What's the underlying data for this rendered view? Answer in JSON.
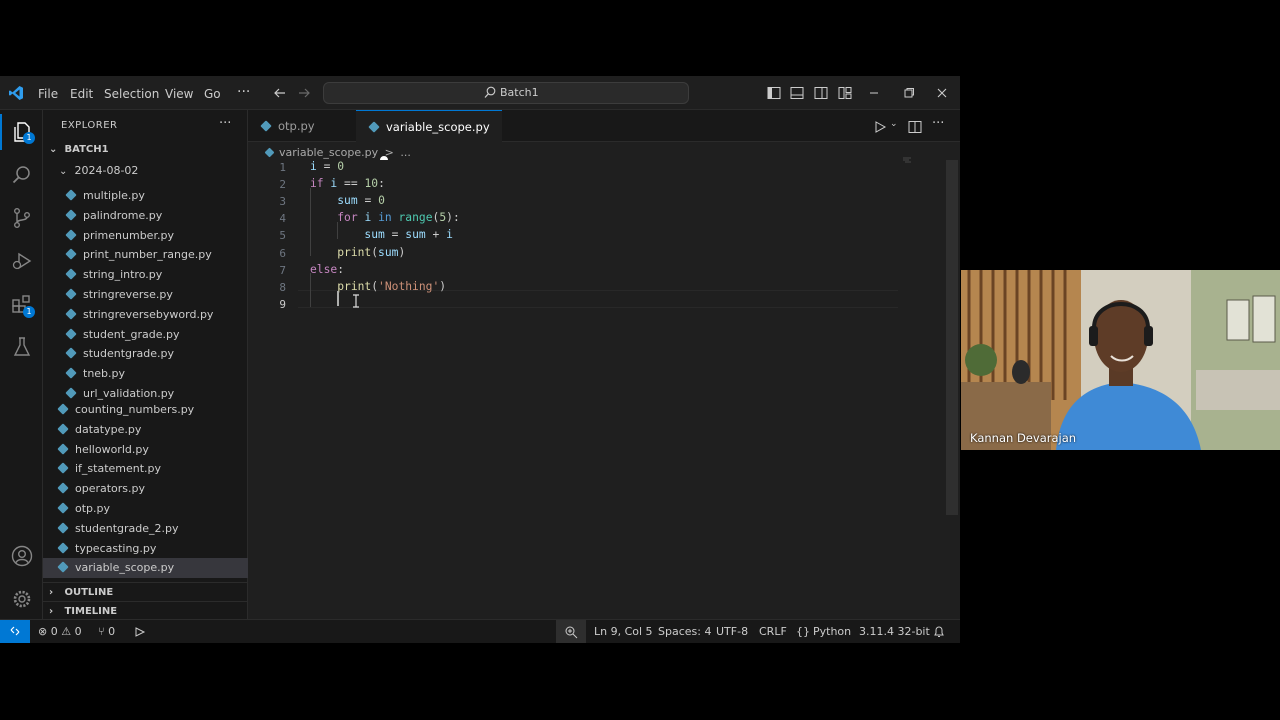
{
  "title_bar": {
    "menu": [
      "File",
      "Edit",
      "Selection",
      "View",
      "Go"
    ],
    "more": "···",
    "search_text": "Batch1"
  },
  "activity_bar": {
    "explorer_badge": "1",
    "extensions_badge": "1"
  },
  "sidebar": {
    "title": "EXPLORER",
    "more": "···",
    "workspace": "BATCH1",
    "folder": "2024-08-02",
    "folder_files": [
      "multiple.py",
      "palindrome.py",
      "primenumber.py",
      "print_number_range.py",
      "string_intro.py",
      "stringreverse.py",
      "stringreversebyword.py",
      "student_grade.py",
      "studentgrade.py",
      "tneb.py",
      "url_validation.py"
    ],
    "root_files": [
      "counting_numbers.py",
      "datatype.py",
      "helloworld.py",
      "if_statement.py",
      "operators.py",
      "otp.py",
      "studentgrade_2.py",
      "typecasting.py",
      "variable_scope.py"
    ],
    "active_file": "variable_scope.py",
    "outline": "OUTLINE",
    "timeline": "TIMELINE"
  },
  "tabs": [
    {
      "label": "otp.py",
      "active": false
    },
    {
      "label": "variable_scope.py",
      "active": true,
      "dirty": true
    }
  ],
  "breadcrumb": {
    "file": "variable_scope.py",
    "sep": ">",
    "more": "..."
  },
  "editor": {
    "line_numbers": [
      "1",
      "2",
      "3",
      "4",
      "5",
      "6",
      "7",
      "8",
      "9"
    ],
    "current_line": 9,
    "code_lines": [
      "i = 0",
      "if i == 10:",
      "    sum = 0",
      "    for i in range(5):",
      "        sum = sum + i",
      "    print(sum)",
      "else:",
      "    print('Nothing')",
      "    "
    ]
  },
  "status_bar": {
    "errors": "0",
    "warnings": "0",
    "ports": "0",
    "position": "Ln 9, Col 5",
    "spaces": "Spaces: 4",
    "encoding": "UTF-8",
    "eol": "CRLF",
    "language": "Python",
    "interpreter": "3.11.4 32-bit"
  },
  "video": {
    "speaker": "Kannan Devarajan"
  },
  "colors": {
    "accent": "#0078d4",
    "editor_bg": "#1f1f1f",
    "sidebar_bg": "#181818"
  }
}
